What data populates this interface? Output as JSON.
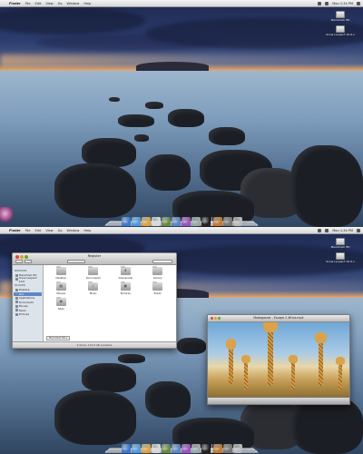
{
  "menubar": {
    "apple": "",
    "items": [
      "Finder",
      "File",
      "Edit",
      "View",
      "Go",
      "Window",
      "Help"
    ],
    "status": "Mon 1:34 PM"
  },
  "desktop_icons": {
    "drive1": "Macintosh HD",
    "drive2": "Snow Leopard 10.6.x"
  },
  "dock": {
    "icons": [
      "finder-icon",
      "globe-icon",
      "compass-icon",
      "ical-icon",
      "photo-icon",
      "itunes-icon",
      "chat-icon",
      "gear-icon",
      "terminal-icon",
      "folder-icon",
      "downloads-icon",
      "trash-icon"
    ]
  },
  "dock_colors": [
    "#3a78d0",
    "#4f9be0",
    "#e0a33a",
    "#d8d8d8",
    "#6a8a3a",
    "#5a86c8",
    "#a050c0",
    "#9aa",
    "#222",
    "#c87a2a",
    "#777",
    "#bbb"
  ],
  "side_label": "",
  "finder": {
    "title": "Register",
    "sidebar_sections": [
      {
        "header": "DEVICES",
        "items": [
          "Macintosh HD",
          "Snow Leopard 10.6"
        ]
      },
      {
        "header": "PLACES",
        "items": [
          "Desktop",
          "Doc",
          "Applications",
          "Documents",
          "Movies",
          "Music",
          "Pictures"
        ]
      }
    ],
    "selected_index": 1,
    "folders": [
      {
        "label": "Desktop",
        "glyph": ""
      },
      {
        "label": "Documents",
        "glyph": ""
      },
      {
        "label": "Downloads",
        "glyph": "⬇"
      },
      {
        "label": "Library",
        "glyph": ""
      },
      {
        "label": "Movies",
        "glyph": "▦"
      },
      {
        "label": "Music",
        "glyph": "♪"
      },
      {
        "label": "Pictures",
        "glyph": "▣"
      },
      {
        "label": "Public",
        "glyph": ""
      },
      {
        "label": "Sites",
        "glyph": "◉"
      }
    ],
    "path": "Macintosh HD ▸",
    "status": "9 items, 123.8 GB available"
  },
  "movie": {
    "title": "Madagascar - Escape 2 Africa.mp4"
  }
}
